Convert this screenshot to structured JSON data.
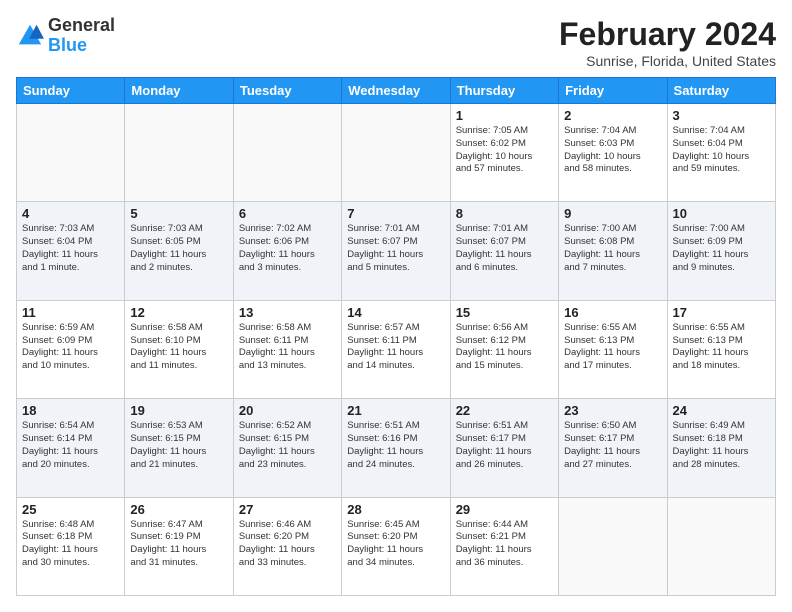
{
  "logo": {
    "general": "General",
    "blue": "Blue"
  },
  "header": {
    "month_year": "February 2024",
    "location": "Sunrise, Florida, United States"
  },
  "weekdays": [
    "Sunday",
    "Monday",
    "Tuesday",
    "Wednesday",
    "Thursday",
    "Friday",
    "Saturday"
  ],
  "weeks": [
    [
      {
        "day": "",
        "info": ""
      },
      {
        "day": "",
        "info": ""
      },
      {
        "day": "",
        "info": ""
      },
      {
        "day": "",
        "info": ""
      },
      {
        "day": "1",
        "info": "Sunrise: 7:05 AM\nSunset: 6:02 PM\nDaylight: 10 hours\nand 57 minutes."
      },
      {
        "day": "2",
        "info": "Sunrise: 7:04 AM\nSunset: 6:03 PM\nDaylight: 10 hours\nand 58 minutes."
      },
      {
        "day": "3",
        "info": "Sunrise: 7:04 AM\nSunset: 6:04 PM\nDaylight: 10 hours\nand 59 minutes."
      }
    ],
    [
      {
        "day": "4",
        "info": "Sunrise: 7:03 AM\nSunset: 6:04 PM\nDaylight: 11 hours\nand 1 minute."
      },
      {
        "day": "5",
        "info": "Sunrise: 7:03 AM\nSunset: 6:05 PM\nDaylight: 11 hours\nand 2 minutes."
      },
      {
        "day": "6",
        "info": "Sunrise: 7:02 AM\nSunset: 6:06 PM\nDaylight: 11 hours\nand 3 minutes."
      },
      {
        "day": "7",
        "info": "Sunrise: 7:01 AM\nSunset: 6:07 PM\nDaylight: 11 hours\nand 5 minutes."
      },
      {
        "day": "8",
        "info": "Sunrise: 7:01 AM\nSunset: 6:07 PM\nDaylight: 11 hours\nand 6 minutes."
      },
      {
        "day": "9",
        "info": "Sunrise: 7:00 AM\nSunset: 6:08 PM\nDaylight: 11 hours\nand 7 minutes."
      },
      {
        "day": "10",
        "info": "Sunrise: 7:00 AM\nSunset: 6:09 PM\nDaylight: 11 hours\nand 9 minutes."
      }
    ],
    [
      {
        "day": "11",
        "info": "Sunrise: 6:59 AM\nSunset: 6:09 PM\nDaylight: 11 hours\nand 10 minutes."
      },
      {
        "day": "12",
        "info": "Sunrise: 6:58 AM\nSunset: 6:10 PM\nDaylight: 11 hours\nand 11 minutes."
      },
      {
        "day": "13",
        "info": "Sunrise: 6:58 AM\nSunset: 6:11 PM\nDaylight: 11 hours\nand 13 minutes."
      },
      {
        "day": "14",
        "info": "Sunrise: 6:57 AM\nSunset: 6:11 PM\nDaylight: 11 hours\nand 14 minutes."
      },
      {
        "day": "15",
        "info": "Sunrise: 6:56 AM\nSunset: 6:12 PM\nDaylight: 11 hours\nand 15 minutes."
      },
      {
        "day": "16",
        "info": "Sunrise: 6:55 AM\nSunset: 6:13 PM\nDaylight: 11 hours\nand 17 minutes."
      },
      {
        "day": "17",
        "info": "Sunrise: 6:55 AM\nSunset: 6:13 PM\nDaylight: 11 hours\nand 18 minutes."
      }
    ],
    [
      {
        "day": "18",
        "info": "Sunrise: 6:54 AM\nSunset: 6:14 PM\nDaylight: 11 hours\nand 20 minutes."
      },
      {
        "day": "19",
        "info": "Sunrise: 6:53 AM\nSunset: 6:15 PM\nDaylight: 11 hours\nand 21 minutes."
      },
      {
        "day": "20",
        "info": "Sunrise: 6:52 AM\nSunset: 6:15 PM\nDaylight: 11 hours\nand 23 minutes."
      },
      {
        "day": "21",
        "info": "Sunrise: 6:51 AM\nSunset: 6:16 PM\nDaylight: 11 hours\nand 24 minutes."
      },
      {
        "day": "22",
        "info": "Sunrise: 6:51 AM\nSunset: 6:17 PM\nDaylight: 11 hours\nand 26 minutes."
      },
      {
        "day": "23",
        "info": "Sunrise: 6:50 AM\nSunset: 6:17 PM\nDaylight: 11 hours\nand 27 minutes."
      },
      {
        "day": "24",
        "info": "Sunrise: 6:49 AM\nSunset: 6:18 PM\nDaylight: 11 hours\nand 28 minutes."
      }
    ],
    [
      {
        "day": "25",
        "info": "Sunrise: 6:48 AM\nSunset: 6:18 PM\nDaylight: 11 hours\nand 30 minutes."
      },
      {
        "day": "26",
        "info": "Sunrise: 6:47 AM\nSunset: 6:19 PM\nDaylight: 11 hours\nand 31 minutes."
      },
      {
        "day": "27",
        "info": "Sunrise: 6:46 AM\nSunset: 6:20 PM\nDaylight: 11 hours\nand 33 minutes."
      },
      {
        "day": "28",
        "info": "Sunrise: 6:45 AM\nSunset: 6:20 PM\nDaylight: 11 hours\nand 34 minutes."
      },
      {
        "day": "29",
        "info": "Sunrise: 6:44 AM\nSunset: 6:21 PM\nDaylight: 11 hours\nand 36 minutes."
      },
      {
        "day": "",
        "info": ""
      },
      {
        "day": "",
        "info": ""
      }
    ]
  ]
}
